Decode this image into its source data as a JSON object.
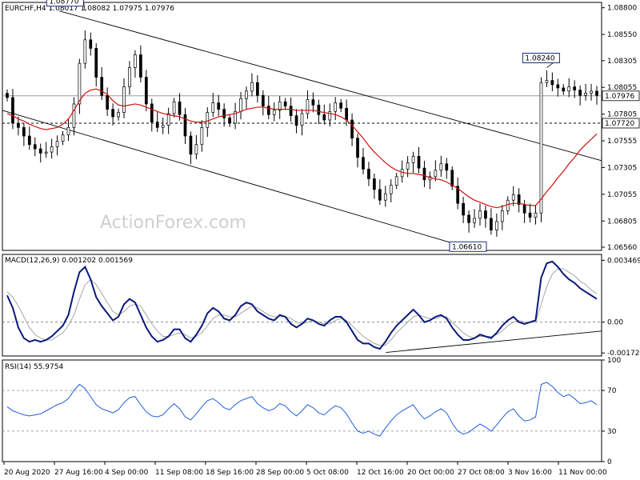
{
  "chart_data": {
    "type": "candlestick",
    "symbol_header": "EURCHF,H4  1.08017 1.08082 1.07975 1.07976",
    "watermark": "ActionForex.com",
    "x_labels": [
      "20 Aug 2020",
      "27 Aug 16:00",
      "4 Sep 00:00",
      "11 Sep 08:00",
      "18 Sep 16:00",
      "28 Sep 00:00",
      "5 Oct 08:00",
      "12 Oct 16:00",
      "20 Oct 00:00",
      "27 Oct 08:00",
      "3 Nov 16:00",
      "11 Nov 00:00"
    ],
    "price_axis": {
      "ylim": [
        1.0653,
        1.0885
      ],
      "ticks": [
        "1.08800",
        "1.08550",
        "1.08305",
        "1.08055",
        "1.07805",
        "1.07555",
        "1.07305",
        "1.07055",
        "1.06805",
        "1.06560"
      ],
      "current_price_label": "1.07976",
      "current_price": 1.07976,
      "horizontal_level_label": "1.07720",
      "horizontal_level": 1.0772
    },
    "annotations": [
      {
        "label": "1.08770",
        "value": 1.0877
      },
      {
        "label": "1.08240",
        "value": 1.0824
      },
      {
        "label": "1.06610",
        "value": 1.0661
      }
    ],
    "close_series": [
      1.0796,
      1.0772,
      1.0768,
      1.076,
      1.0752,
      1.0748,
      1.0744,
      1.0745,
      1.075,
      1.0755,
      1.0761,
      1.0768,
      1.079,
      1.0828,
      1.085,
      1.0842,
      1.0815,
      1.0798,
      1.0785,
      1.0778,
      1.0782,
      1.0806,
      1.0824,
      1.0836,
      1.0815,
      1.079,
      1.0773,
      1.0768,
      1.077,
      1.0781,
      1.0792,
      1.078,
      1.076,
      1.0743,
      1.0752,
      1.0768,
      1.0782,
      1.0791,
      1.0785,
      1.0777,
      1.0772,
      1.0783,
      1.0795,
      1.0802,
      1.081,
      1.0798,
      1.0788,
      1.078,
      1.0784,
      1.0792,
      1.0788,
      1.0779,
      1.077,
      1.0781,
      1.0794,
      1.0789,
      1.078,
      1.0775,
      1.0783,
      1.0791,
      1.0786,
      1.0775,
      1.0758,
      1.074,
      1.0729,
      1.072,
      1.071,
      1.07,
      1.0706,
      1.0714,
      1.0722,
      1.0729,
      1.0735,
      1.0741,
      1.073,
      1.0719,
      1.0722,
      1.0728,
      1.0734,
      1.0728,
      1.0713,
      1.0697,
      1.0686,
      1.0679,
      1.0683,
      1.069,
      1.0683,
      1.0672,
      1.068,
      1.069,
      1.07,
      1.0705,
      1.0696,
      1.0688,
      1.0684,
      1.0688,
      1.081,
      1.0812,
      1.0808,
      1.0805,
      1.0802,
      1.0806,
      1.0803,
      1.0798,
      1.08,
      1.0802,
      1.0798
    ],
    "moving_average": [
      1.0781,
      1.0779,
      1.0776,
      1.0774,
      1.0771,
      1.0769,
      1.0767,
      1.0766,
      1.0767,
      1.0768,
      1.0771,
      1.0776,
      1.0784,
      1.0793,
      1.08,
      1.0803,
      1.0804,
      1.0802,
      1.0799,
      1.0793,
      1.0789,
      1.0788,
      1.0789,
      1.079,
      1.0789,
      1.0787,
      1.0785,
      1.0783,
      1.0781,
      1.078,
      1.0779,
      1.0778,
      1.0776,
      1.0774,
      1.0773,
      1.0773,
      1.0774,
      1.0776,
      1.0778,
      1.0779,
      1.078,
      1.0781,
      1.0783,
      1.0785,
      1.0786,
      1.0787,
      1.0787,
      1.0786,
      1.0785,
      1.0785,
      1.0785,
      1.0785,
      1.0784,
      1.0784,
      1.0784,
      1.0784,
      1.0783,
      1.0782,
      1.0781,
      1.078,
      1.0778,
      1.0775,
      1.077,
      1.0764,
      1.0758,
      1.0751,
      1.0745,
      1.074,
      1.0735,
      1.0731,
      1.0728,
      1.0726,
      1.0725,
      1.0725,
      1.0724,
      1.0723,
      1.0721,
      1.072,
      1.0719,
      1.0717,
      1.0714,
      1.0711,
      1.0707,
      1.0703,
      1.07,
      1.0698,
      1.0696,
      1.0694,
      1.0693,
      1.0694,
      1.0696,
      1.0697,
      1.0697,
      1.0696,
      1.0695,
      1.0695,
      1.0701,
      1.0708,
      1.0714,
      1.0721,
      1.0727,
      1.0734,
      1.074,
      1.0747,
      1.0752,
      1.0757,
      1.0762
    ],
    "macd": {
      "label": "MACD(12,26,9) 0.001202 0.001569",
      "ylim": [
        -0.0019,
        0.0038
      ],
      "ticks": [
        "0.003469",
        "0.00",
        "-0.001729"
      ],
      "macd_series": [
        0.0015,
        0.0008,
        -0.0003,
        -0.0009,
        -0.0011,
        -0.001,
        -0.0011,
        -0.001,
        -0.0008,
        -0.0005,
        -0.0002,
        0.0004,
        0.0017,
        0.0028,
        0.0031,
        0.0024,
        0.0014,
        0.0009,
        0.0005,
        0.0001,
        0.0003,
        0.001,
        0.0013,
        0.0011,
        0.0004,
        -0.0003,
        -0.0008,
        -0.0011,
        -0.001,
        -0.0008,
        -0.0004,
        -0.0004,
        -0.0009,
        -0.0011,
        -0.0007,
        -0.0002,
        0.0005,
        0.0008,
        0.0006,
        0.0002,
        0.0001,
        0.0004,
        0.0009,
        0.0011,
        0.001,
        0.0006,
        0.0004,
        0.0002,
        0.0001,
        0.0004,
        0.0003,
        -0.0001,
        -0.0003,
        -0.0001,
        0.0002,
        0.0001,
        -0.0001,
        -0.0002,
        0.0001,
        0.0003,
        0.0003,
        0.0,
        -0.0005,
        -0.001,
        -0.0012,
        -0.0012,
        -0.0014,
        -0.0015,
        -0.0011,
        -0.0006,
        -0.0002,
        0.0001,
        0.0004,
        0.0007,
        0.0004,
        0.0,
        0.0001,
        0.0003,
        0.0004,
        0.0002,
        -0.0003,
        -0.0007,
        -0.001,
        -0.001,
        -0.0009,
        -0.0007,
        -0.0008,
        -0.0009,
        -0.0006,
        -0.0002,
        0.0001,
        0.0003,
        0.0,
        -0.0001,
        0.0,
        0.0001,
        0.0025,
        0.0033,
        0.0034,
        0.0031,
        0.0027,
        0.0024,
        0.0022,
        0.0019,
        0.0017,
        0.0015,
        0.0013
      ],
      "signal_series": [
        0.0017,
        0.0014,
        0.0009,
        0.0003,
        -0.0003,
        -0.0007,
        -0.0009,
        -0.001,
        -0.001,
        -0.0008,
        -0.0006,
        -0.0002,
        0.0004,
        0.0013,
        0.0021,
        0.0024,
        0.0021,
        0.0016,
        0.0011,
        0.0006,
        0.0004,
        0.0006,
        0.0009,
        0.001,
        0.0009,
        0.0004,
        -0.0001,
        -0.0005,
        -0.0008,
        -0.0008,
        -0.0007,
        -0.0006,
        -0.0007,
        -0.0009,
        -0.0008,
        -0.0006,
        -0.0002,
        0.0002,
        0.0004,
        0.0004,
        0.0003,
        0.0003,
        0.0005,
        0.0007,
        0.0009,
        0.0008,
        0.0006,
        0.0004,
        0.0003,
        0.0003,
        0.0003,
        0.0002,
        0.0,
        -0.0001,
        0.0,
        0.0001,
        0.0,
        -0.0001,
        -0.0001,
        0.0001,
        0.0002,
        0.0001,
        -0.0002,
        -0.0005,
        -0.0008,
        -0.001,
        -0.0012,
        -0.0013,
        -0.0013,
        -0.001,
        -0.0006,
        -0.0003,
        0.0,
        0.0003,
        0.0004,
        0.0003,
        0.0002,
        0.0002,
        0.0003,
        0.0003,
        0.0,
        -0.0003,
        -0.0006,
        -0.0008,
        -0.0009,
        -0.0008,
        -0.0008,
        -0.0008,
        -0.0007,
        -0.0005,
        -0.0002,
        0.0,
        0.0001,
        0.0,
        0.0,
        0.0,
        0.001,
        0.002,
        0.0027,
        0.003,
        0.003,
        0.0028,
        0.0026,
        0.0023,
        0.0021,
        0.0018,
        0.0016
      ],
      "trendline": [
        [
          0.64,
          -0.0017
        ],
        [
          1.0,
          -0.0005
        ]
      ]
    },
    "rsi": {
      "label": "RSI(14) 55.9754",
      "ylim": [
        0,
        100
      ],
      "ticks": [
        "100",
        "70",
        "30",
        "0"
      ],
      "levels": [
        70,
        30
      ],
      "series": [
        54,
        50,
        48,
        46,
        45,
        46,
        47,
        50,
        53,
        56,
        58,
        62,
        70,
        76,
        72,
        64,
        56,
        52,
        50,
        48,
        51,
        58,
        63,
        64,
        56,
        49,
        45,
        44,
        46,
        52,
        57,
        52,
        44,
        41,
        47,
        54,
        60,
        62,
        58,
        53,
        51,
        56,
        60,
        62,
        64,
        57,
        53,
        50,
        52,
        57,
        55,
        49,
        45,
        50,
        56,
        53,
        48,
        46,
        51,
        55,
        53,
        47,
        38,
        30,
        28,
        30,
        27,
        25,
        33,
        40,
        46,
        50,
        53,
        56,
        48,
        42,
        45,
        49,
        52,
        48,
        38,
        30,
        27,
        29,
        33,
        37,
        34,
        30,
        36,
        43,
        49,
        52,
        45,
        40,
        41,
        44,
        76,
        78,
        74,
        68,
        64,
        66,
        62,
        57,
        58,
        60,
        56
      ],
      "current_value": 55.9754
    },
    "channel_lines": {
      "upper": [
        [
          0.095,
          1.0877
        ],
        [
          1.0,
          1.0737
        ]
      ],
      "lower": [
        [
          0.0,
          1.0784
        ],
        [
          0.75,
          1.066
        ]
      ]
    },
    "colors": {
      "up": "#000000",
      "down": "#000000",
      "ma": "#d11010",
      "macd": "#0a1a7a",
      "signal": "#a6a6a6",
      "rsi": "#1e5fd6",
      "guides": "#7a7a7a"
    }
  }
}
